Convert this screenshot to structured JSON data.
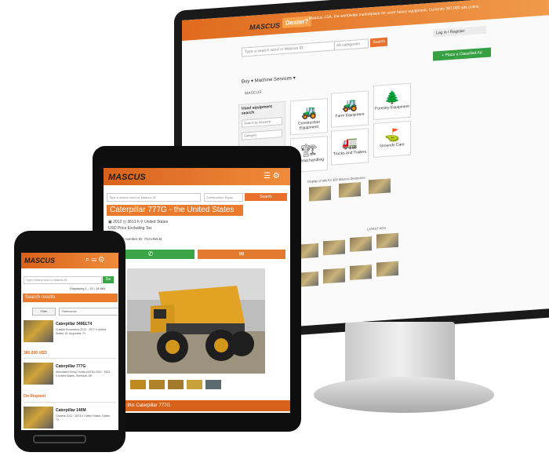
{
  "brand": {
    "name": "MASCUS",
    "accent": "#e8702a",
    "green": "#3aa546"
  },
  "desktop": {
    "dealer_label": "Dealer?",
    "header_message": "Mascus USA, the worldwide marketplace for used heavy equipment. Currently 387,000 ads online.",
    "search_placeholder": "Type a search word or Mascus ID",
    "category_select": "All categories",
    "search_button": "Search",
    "login_label": "Log in / Register",
    "place_ad_button": "+ Place a Classified Ad",
    "nav": "Buy ▾   Machine Services ▾",
    "breadcrumb": "MASCUS",
    "sidebar_title": "Used equipment search",
    "sidebar_field_1": "Search by keyword",
    "sidebar_field_2": "Category",
    "categories": [
      {
        "icon": "construction-icon",
        "glyph": "🚜",
        "label": "Construction Equipment"
      },
      {
        "icon": "farm-icon",
        "glyph": "🚜",
        "label": "Farm Equipment"
      },
      {
        "icon": "forestry-icon",
        "glyph": "🌲",
        "label": "Forestry Equipment"
      },
      {
        "icon": "material-icon",
        "glyph": "🏗",
        "label": "Material handling"
      },
      {
        "icon": "truck-icon",
        "glyph": "🚛",
        "label": "Trucks and Trailers"
      },
      {
        "icon": "grounds-icon",
        "glyph": "⛳",
        "label": "Grounds Care"
      }
    ],
    "latest_label": "Display of ads for 100 Mascus Deutsches",
    "latest_sub": "LATEST ADS"
  },
  "tablet": {
    "search_placeholder": "Type a search word or Mascus ID",
    "condition_placeholder": "Construction Equip",
    "go_label": "Search",
    "title": "Caterpillar 777G - the United States",
    "specs": "▣ 2012  ◷ 3613 h  ⚲ United States",
    "vat": "USD Price Excluding Tax",
    "reference": "Reference number ID: 7GAHWLM",
    "call_icon": "phone-icon",
    "mail_icon": "envelope-icon",
    "bottom_link": "See this Caterpillar 777G"
  },
  "phone": {
    "search_placeholder": "Type a search word or Mascus ID",
    "go_label": "Go",
    "display": "Displaying 1 - 20 / 18 684",
    "results_title": "Search results",
    "filter_label": "Filter",
    "sort_label": "Relevance",
    "listings": [
      {
        "name": "Caterpillar 349ELT4",
        "desc": "Crawler Excavators 2013 · 3377 h United States, St. Augustine, FL",
        "price": "380,000 USD"
      },
      {
        "name": "Caterpillar 777G",
        "desc": "Articulated Dump Trucks (ADTs) 2012 · 9424 h United States, Sheridan, AR",
        "price": "On Request"
      },
      {
        "name": "Caterpillar 140M",
        "desc": "Graders 2012 · 5874 h United States, Dallas, TX",
        "price": ""
      }
    ]
  }
}
